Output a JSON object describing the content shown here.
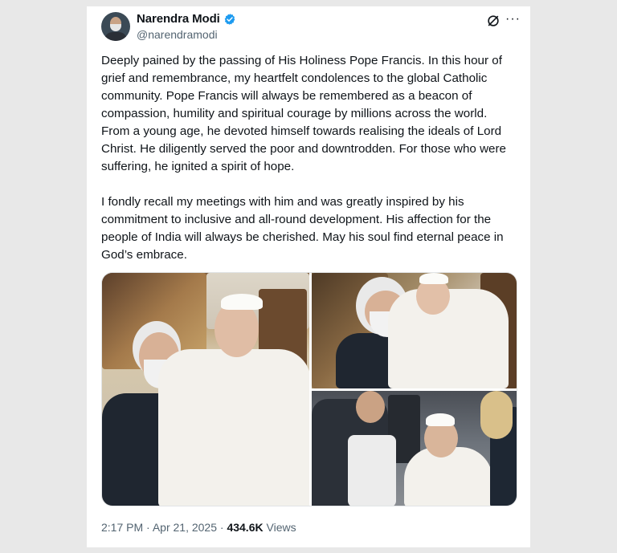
{
  "tweet": {
    "author_name": "Narendra Modi",
    "author_handle": "@narendramodi",
    "text": "Deeply pained by the passing of His Holiness Pope Francis. In this hour of grief and remembrance, my heartfelt condolences to the global Catholic community. Pope Francis will always be remembered as a beacon of compassion, humility and spiritual courage by millions across the world. From a young age, he devoted himself towards realising the ideals of Lord Christ. He diligently served the poor and downtrodden. For those who were suffering, he ignited a spirit of hope.\n\nI fondly recall my meetings with him and was greatly inspired by his commitment to inclusive and all-round development. His affection for the people of India will always be cherished. May his soul find eternal peace in God’s embrace.",
    "time": "2:17 PM",
    "separator": "·",
    "date": "Apr 21, 2025",
    "views_count": "434.6K",
    "views_label": "Views"
  },
  "icons": {
    "verified": "verified-badge-icon",
    "grok": "grok-icon",
    "more": "more-options-icon"
  },
  "colors": {
    "text": "#0f1419",
    "secondary": "#536471",
    "verified": "#1d9bf0"
  }
}
